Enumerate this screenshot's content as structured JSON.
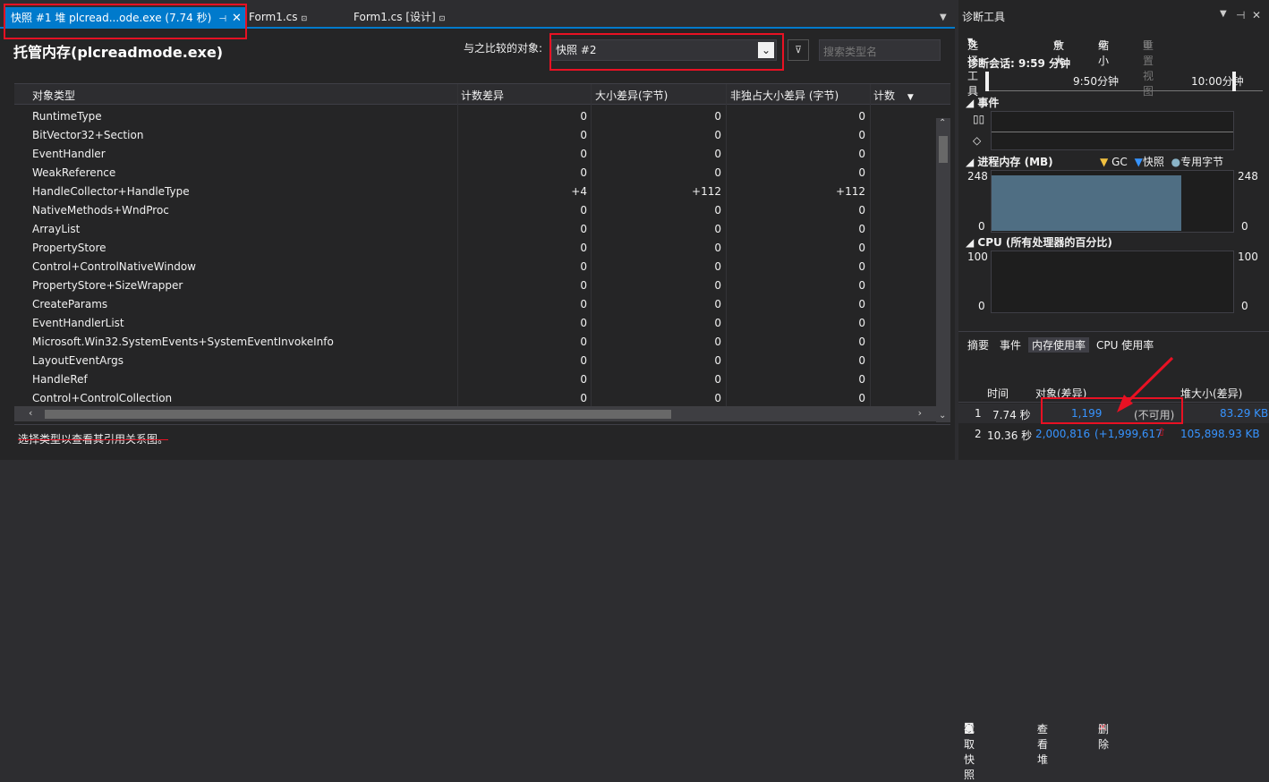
{
  "tabs": [
    {
      "label": "快照 #1 堆 plcread...ode.exe (7.74 秒)",
      "active": true
    },
    {
      "label": "Form1.cs"
    },
    {
      "label": "Form1.cs [设计]"
    }
  ],
  "main": {
    "title": "托管内存(plcreadmode.exe)",
    "compare_label": "与之比较的对象:",
    "compare_value": "快照 #2",
    "search_placeholder": "搜索类型名",
    "columns": [
      "对象类型",
      "计数差异",
      "大小差异(字节)",
      "非独占大小差异 (字节)",
      "计数"
    ],
    "rows": [
      {
        "type": "RuntimeType",
        "count": "0",
        "size": "0",
        "incl": "0"
      },
      {
        "type": "BitVector32+Section",
        "count": "0",
        "size": "0",
        "incl": "0"
      },
      {
        "type": "EventHandler",
        "count": "0",
        "size": "0",
        "incl": "0"
      },
      {
        "type": "WeakReference",
        "count": "0",
        "size": "0",
        "incl": "0"
      },
      {
        "type": "HandleCollector+HandleType",
        "count": "+4",
        "size": "+112",
        "incl": "+112"
      },
      {
        "type": "NativeMethods+WndProc",
        "count": "0",
        "size": "0",
        "incl": "0"
      },
      {
        "type": "ArrayList",
        "count": "0",
        "size": "0",
        "incl": "0"
      },
      {
        "type": "PropertyStore",
        "count": "0",
        "size": "0",
        "incl": "0"
      },
      {
        "type": "Control+ControlNativeWindow",
        "count": "0",
        "size": "0",
        "incl": "0"
      },
      {
        "type": "PropertyStore+SizeWrapper",
        "count": "0",
        "size": "0",
        "incl": "0"
      },
      {
        "type": "CreateParams",
        "count": "0",
        "size": "0",
        "incl": "0"
      },
      {
        "type": "EventHandlerList",
        "count": "0",
        "size": "0",
        "incl": "0"
      },
      {
        "type": "Microsoft.Win32.SystemEvents+SystemEventInvokeInfo",
        "count": "0",
        "size": "0",
        "incl": "0"
      },
      {
        "type": "LayoutEventArgs",
        "count": "0",
        "size": "0",
        "incl": "0"
      },
      {
        "type": "HandleRef",
        "count": "0",
        "size": "0",
        "incl": "0"
      },
      {
        "type": "Control+ControlCollection",
        "count": "0",
        "size": "0",
        "incl": "0"
      }
    ],
    "status_msg": "选择类型以查看其引用关系图。"
  },
  "diag": {
    "title": "诊断工具",
    "toolbar": {
      "select": "选择工具",
      "zoom_in": "放大",
      "zoom_out": "缩小",
      "reset": "重置视图"
    },
    "session": "诊断会话: 9:59 分钟",
    "timeline": [
      "9:50分钟",
      "10:00分钟"
    ],
    "events_title": "事件",
    "mem_title": "进程内存 (MB)",
    "mem_legend": [
      "GC",
      "快照",
      "专用字节"
    ],
    "mem_max": "248",
    "mem_min": "0",
    "cpu_title": "CPU (所有处理器的百分比)",
    "cpu_max": "100",
    "cpu_min": "0",
    "tabs": [
      "摘要",
      "事件",
      "内存使用率",
      "CPU 使用率"
    ],
    "actions": [
      "截取快照",
      "查看堆",
      "删除"
    ],
    "snap_cols": [
      "时间",
      "对象(差异)",
      "堆大小(差异)"
    ],
    "snaps": [
      {
        "id": "1",
        "time": "7.74 秒",
        "objects": "1,199",
        "obj_diff": "(不可用)",
        "heap": "83.29 KB"
      },
      {
        "id": "2",
        "time": "10.36 秒",
        "objects": "2,000,816",
        "obj_diff": "(+1,999,617",
        "heap": "105,898.93 KB"
      }
    ]
  }
}
